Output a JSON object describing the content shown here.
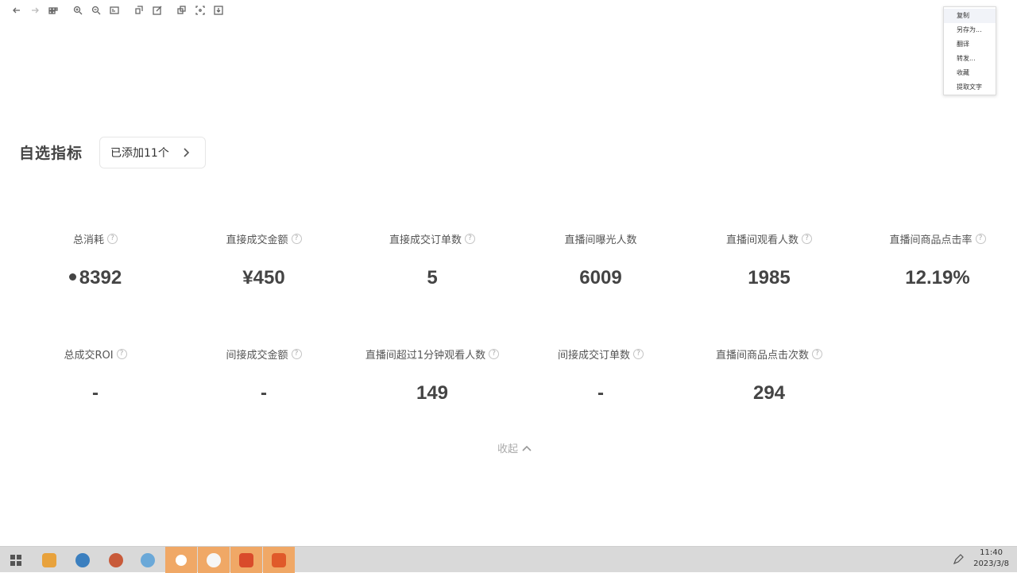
{
  "toolbar": {
    "icons": [
      "back-icon",
      "forward-icon",
      "grid-icon",
      "zoom-in-icon",
      "zoom-out-icon",
      "fit-icon",
      "rotate-icon",
      "edit-icon",
      "copy-icon",
      "crop-icon",
      "save-icon"
    ]
  },
  "context_menu": {
    "items": [
      "复制",
      "另存为...",
      "翻译",
      "转发...",
      "收藏",
      "提取文字"
    ]
  },
  "section": {
    "title": "自选指标",
    "added_label": "已添加11个"
  },
  "metrics_row1": [
    {
      "label": "总消耗",
      "value": "8392",
      "has_dot": true
    },
    {
      "label": "直接成交金额",
      "value": "¥450"
    },
    {
      "label": "直接成交订单数",
      "value": "5"
    },
    {
      "label": "直播间曝光人数",
      "value": "6009",
      "has_help": false
    },
    {
      "label": "直播间观看人数",
      "value": "1985"
    },
    {
      "label": "直播间商品点击率",
      "value": "12.19%"
    }
  ],
  "metrics_row2": [
    {
      "label": "总成交ROI",
      "value": "-"
    },
    {
      "label": "间接成交金额",
      "value": "-"
    },
    {
      "label": "直播间超过1分钟观看人数",
      "value": "149"
    },
    {
      "label": "间接成交订单数",
      "value": "-"
    },
    {
      "label": "直播间商品点击次数",
      "value": "294"
    }
  ],
  "collapse_label": "收起",
  "taskbar": {
    "time": "11:40",
    "date": "2023/3/8",
    "apps": [
      "windows-icon",
      "folder-icon",
      "edge-icon",
      "app-icon",
      "app-icon",
      "app-icon",
      "app-icon",
      "wps-icon",
      "pdf-icon"
    ]
  },
  "colors": {
    "taskbar_active": "#f0a866",
    "text_dark": "#444444"
  }
}
